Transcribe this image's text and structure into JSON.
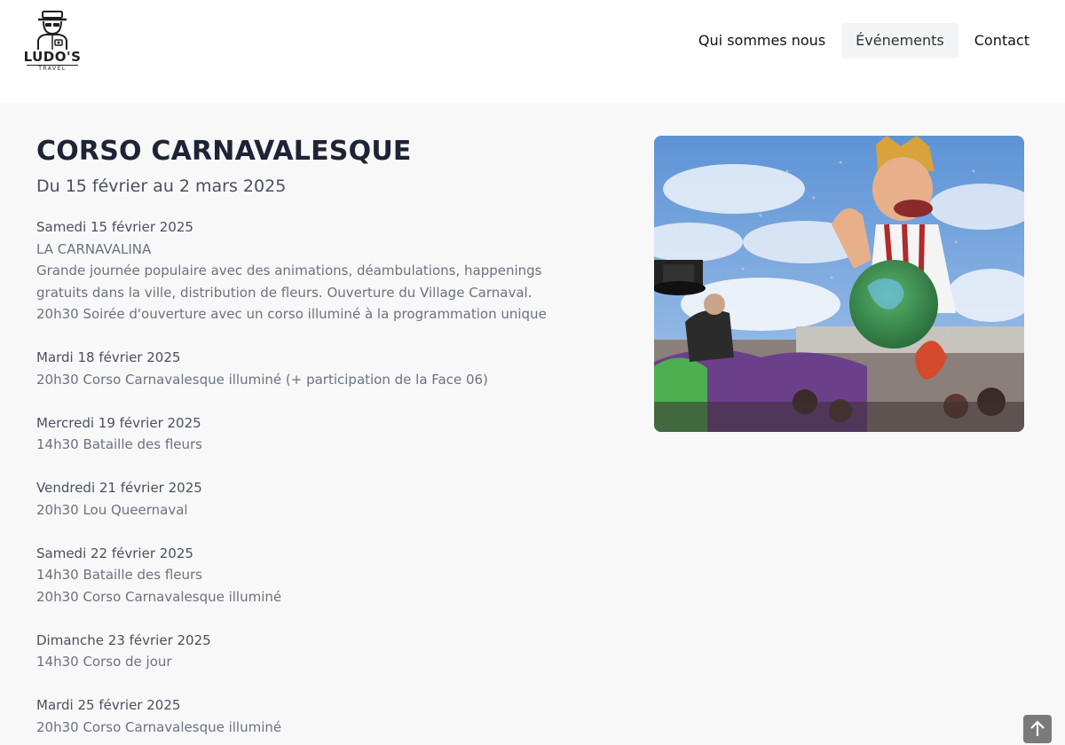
{
  "header": {
    "logo": {
      "name": "LUDO'S",
      "tagline": "TRAVEL"
    },
    "nav": [
      {
        "label": "Qui sommes nous",
        "active": false
      },
      {
        "label": "Événements",
        "active": true
      },
      {
        "label": "Contact",
        "active": false
      }
    ]
  },
  "main": {
    "title": "CORSO CARNAVALESQUE",
    "dates": "Du 15 février au 2 mars 2025",
    "events": [
      {
        "day": "Samedi 15 février 2025",
        "lines": [
          "LA CARNAVALINA",
          "Grande journée populaire avec des animations, déambulations, happenings",
          "gratuits dans la ville, distribution de fleurs. Ouverture du Village Carnaval.",
          "20h30 Soirée d'ouverture avec un corso illuminé à la programmation unique"
        ]
      },
      {
        "day": "Mardi 18 février 2025",
        "lines": [
          "20h30 Corso Carnavalesque illuminé (+ participation de la Face 06)"
        ]
      },
      {
        "day": "Mercredi 19 février 2025",
        "lines": [
          "14h30 Bataille des fleurs"
        ]
      },
      {
        "day": "Vendredi 21 février 2025",
        "lines": [
          "20h30 Lou Queernaval"
        ]
      },
      {
        "day": "Samedi 22 février 2025",
        "lines": [
          "14h30 Bataille des fleurs",
          "20h30 Corso Carnavalesque illuminé"
        ]
      },
      {
        "day": "Dimanche 23 février 2025",
        "lines": [
          "14h30 Corso de jour"
        ]
      },
      {
        "day": "Mardi 25 février 2025",
        "lines": [
          "20h30 Corso Carnavalesque illuminé"
        ]
      }
    ]
  },
  "icons": {
    "logo": "traveler-icon",
    "scroll_top": "arrow-up-icon"
  },
  "colors": {
    "title": "#1e2436",
    "background": "#f8f8f9",
    "nav_active_bg": "#f3f4f6"
  }
}
